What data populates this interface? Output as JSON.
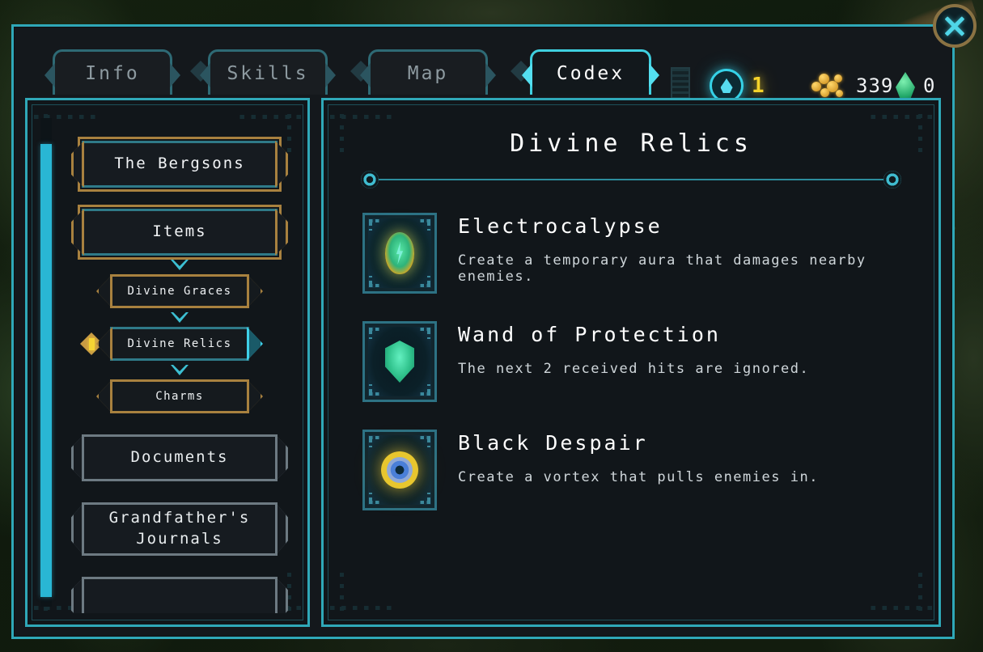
{
  "window": {
    "close_label": "×"
  },
  "tabs": [
    {
      "label": "Info",
      "active": false
    },
    {
      "label": "Skills",
      "active": false
    },
    {
      "label": "Map",
      "active": false
    },
    {
      "label": "Codex",
      "active": true
    }
  ],
  "currencies": [
    {
      "icon": "soul-orb-icon",
      "value": "1",
      "color": "#f5d32a"
    },
    {
      "icon": "gold-coins-icon",
      "value": "339",
      "color": "#f0f2f4"
    },
    {
      "icon": "green-gem-icon",
      "value": "0",
      "color": "#f0f2f4"
    }
  ],
  "sidebar": {
    "items": [
      {
        "label": "The Bergsons",
        "type": "category",
        "style": "gold",
        "selected": false
      },
      {
        "label": "Items",
        "type": "category",
        "style": "gold",
        "selected": false
      },
      {
        "label": "Divine Graces",
        "type": "sub",
        "style": "gold",
        "selected": false
      },
      {
        "label": "Divine Relics",
        "type": "sub",
        "style": "gold",
        "selected": true
      },
      {
        "label": "Charms",
        "type": "sub",
        "style": "gold",
        "selected": false
      },
      {
        "label": "Documents",
        "type": "category",
        "style": "grey",
        "selected": false
      },
      {
        "label": "Grandfather's Journals",
        "type": "category",
        "style": "grey",
        "selected": false
      }
    ]
  },
  "main": {
    "title": "Divine Relics",
    "relics": [
      {
        "name": "Electrocalypse",
        "description": "Create a temporary aura that damages nearby enemies.",
        "icon": "lightning-bolt-relic-icon"
      },
      {
        "name": "Wand of Protection",
        "description": "The next 2 received hits are ignored.",
        "icon": "shield-relic-icon"
      },
      {
        "name": "Black Despair",
        "description": "Create a vortex that pulls enemies in.",
        "icon": "vortex-eye-relic-icon"
      }
    ]
  },
  "colors": {
    "accent_cyan": "#2fa8b8",
    "bright_cyan": "#3fd0e0",
    "gold_border": "#a8813f",
    "grey_border": "#6d7a82",
    "gold_text": "#f5d32a"
  }
}
